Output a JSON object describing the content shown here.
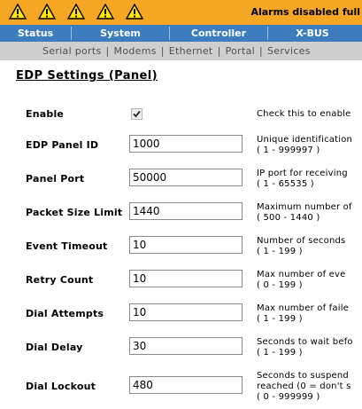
{
  "alarm_bar": {
    "warning_count": 5,
    "text": "Alarms disabled full",
    "color": "#f5a623"
  },
  "nav": {
    "items": [
      {
        "label": "Status"
      },
      {
        "label": "System"
      },
      {
        "label": "Controller"
      },
      {
        "label": "X-BUS"
      }
    ],
    "color": "#3b7dbf"
  },
  "subnav": {
    "items": [
      {
        "label": "Serial ports"
      },
      {
        "label": "Modems"
      },
      {
        "label": "Ethernet"
      },
      {
        "label": "Portal"
      },
      {
        "label": "Services"
      }
    ],
    "separator": "|"
  },
  "page": {
    "title": "EDP Settings (Panel)"
  },
  "form": {
    "enable": {
      "label": "Enable",
      "checked": true,
      "desc_line1": "Check this to enable"
    },
    "fields": [
      {
        "label": "EDP Panel ID",
        "value": "1000",
        "desc_line1": "Unique identification",
        "desc_line2": "( 1 - 999997 )"
      },
      {
        "label": "Panel Port",
        "value": "50000",
        "desc_line1": "IP port for receiving",
        "desc_line2": "( 1 - 65535 )"
      },
      {
        "label": "Packet Size Limit",
        "value": "1440",
        "desc_line1": "Maximum number of",
        "desc_line2": "( 500 - 1440 )"
      },
      {
        "label": "Event Timeout",
        "value": "10",
        "desc_line1": "Number of seconds",
        "desc_line2": "( 1 - 199 )"
      },
      {
        "label": "Retry Count",
        "value": "10",
        "desc_line1": "Max number of eve",
        "desc_line2": "( 0 - 199 )"
      },
      {
        "label": "Dial Attempts",
        "value": "10",
        "desc_line1": "Max number of faile",
        "desc_line2": "( 1 - 199 )"
      },
      {
        "label": "Dial Delay",
        "value": "30",
        "desc_line1": "Seconds to wait befo",
        "desc_line2": "( 1 - 199 )"
      },
      {
        "label": "Dial Lockout",
        "value": "480",
        "desc_line1": "Seconds to suspend",
        "desc_line2": "reached (0 = don't s",
        "desc_line3": "( 0 - 999999 )"
      }
    ]
  }
}
